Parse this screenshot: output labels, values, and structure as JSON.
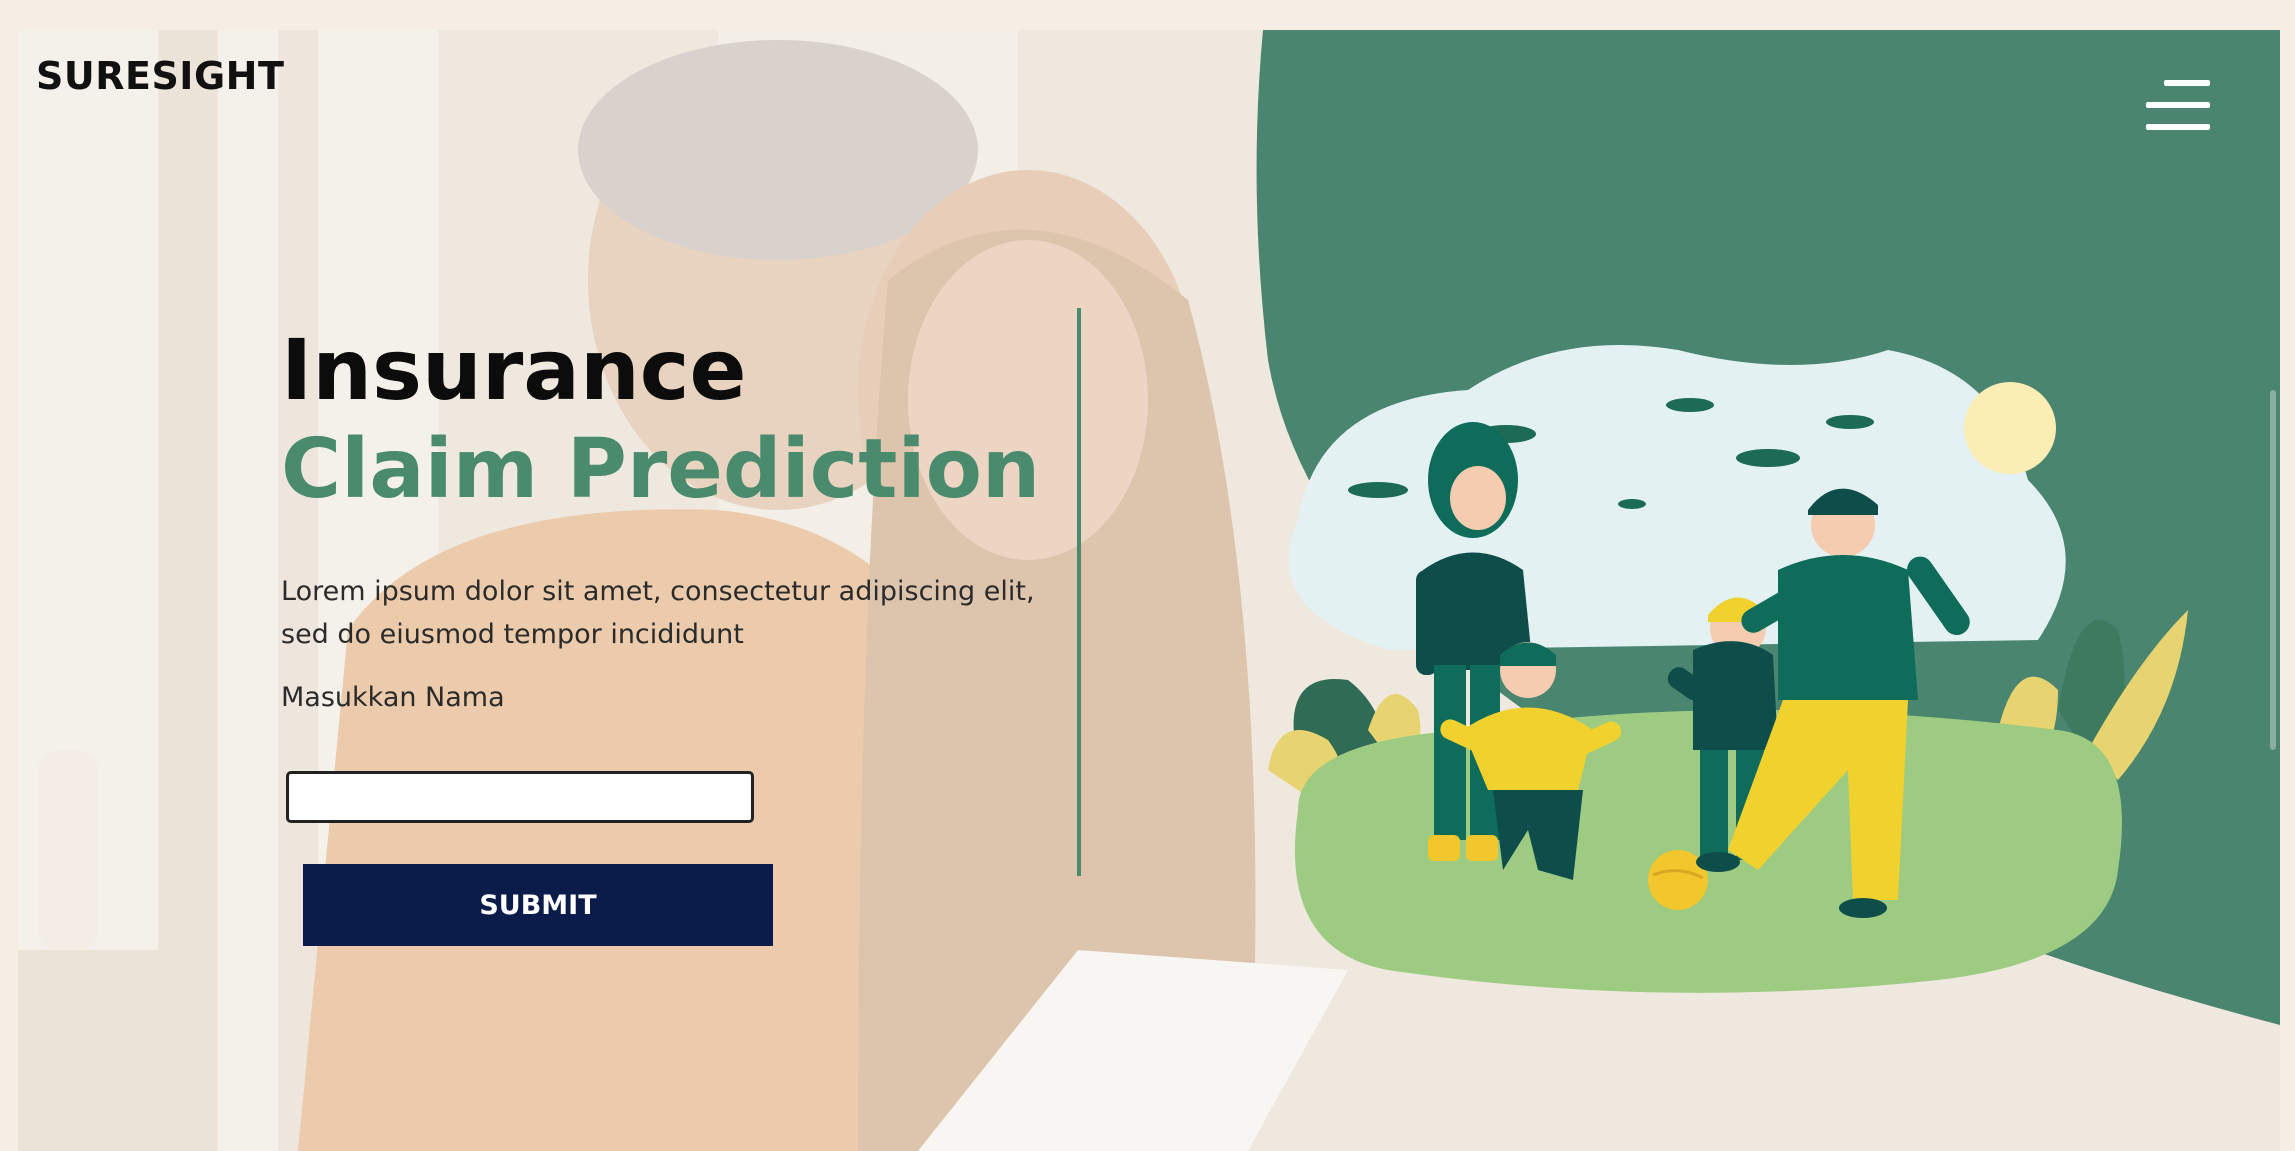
{
  "brand": {
    "name": "SURESIGHT"
  },
  "header": {
    "menu_icon": "hamburger-menu-icon"
  },
  "hero": {
    "title_line1": "Insurance",
    "title_line2": "Claim Prediction",
    "description_line1": "Lorem ipsum dolor sit amet, consectetur adipiscing elit,",
    "description_line2": "sed do eiusmod tempor incididunt"
  },
  "form": {
    "name_label": "Masukkan Nama",
    "name_value": "",
    "submit_label": "SUBMIT"
  },
  "colors": {
    "accent_green": "#4a8b6d",
    "panel_green": "#4a8570",
    "button_navy": "#0b1b4a",
    "title_dark": "#0c0c0c"
  }
}
